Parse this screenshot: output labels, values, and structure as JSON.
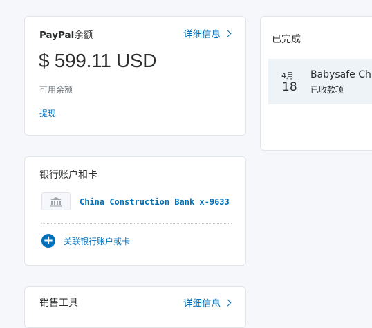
{
  "balance": {
    "title_brand": "PayPal",
    "title_suffix": "余额",
    "details_label": "详细信息",
    "amount": "$ 599.11 USD",
    "sub_label": "可用余额",
    "withdraw_label": "提现"
  },
  "activity": {
    "title": "已完成",
    "items": [
      {
        "month": "4月",
        "day": "18",
        "name": "Babysafe Chi",
        "status": "已收款项"
      }
    ]
  },
  "banks": {
    "title": "银行账户和卡",
    "accounts": [
      {
        "name": "China Construction Bank x-9633",
        "icon": "bank-icon"
      }
    ],
    "link_label": "关联银行账户或卡"
  },
  "seller_tools": {
    "title": "销售工具",
    "details_label": "详细信息"
  },
  "colors": {
    "accent": "#0070ba",
    "page_bg": "#f5f7fa",
    "card_bg": "#ffffff",
    "row_highlight": "#eef3f8"
  }
}
